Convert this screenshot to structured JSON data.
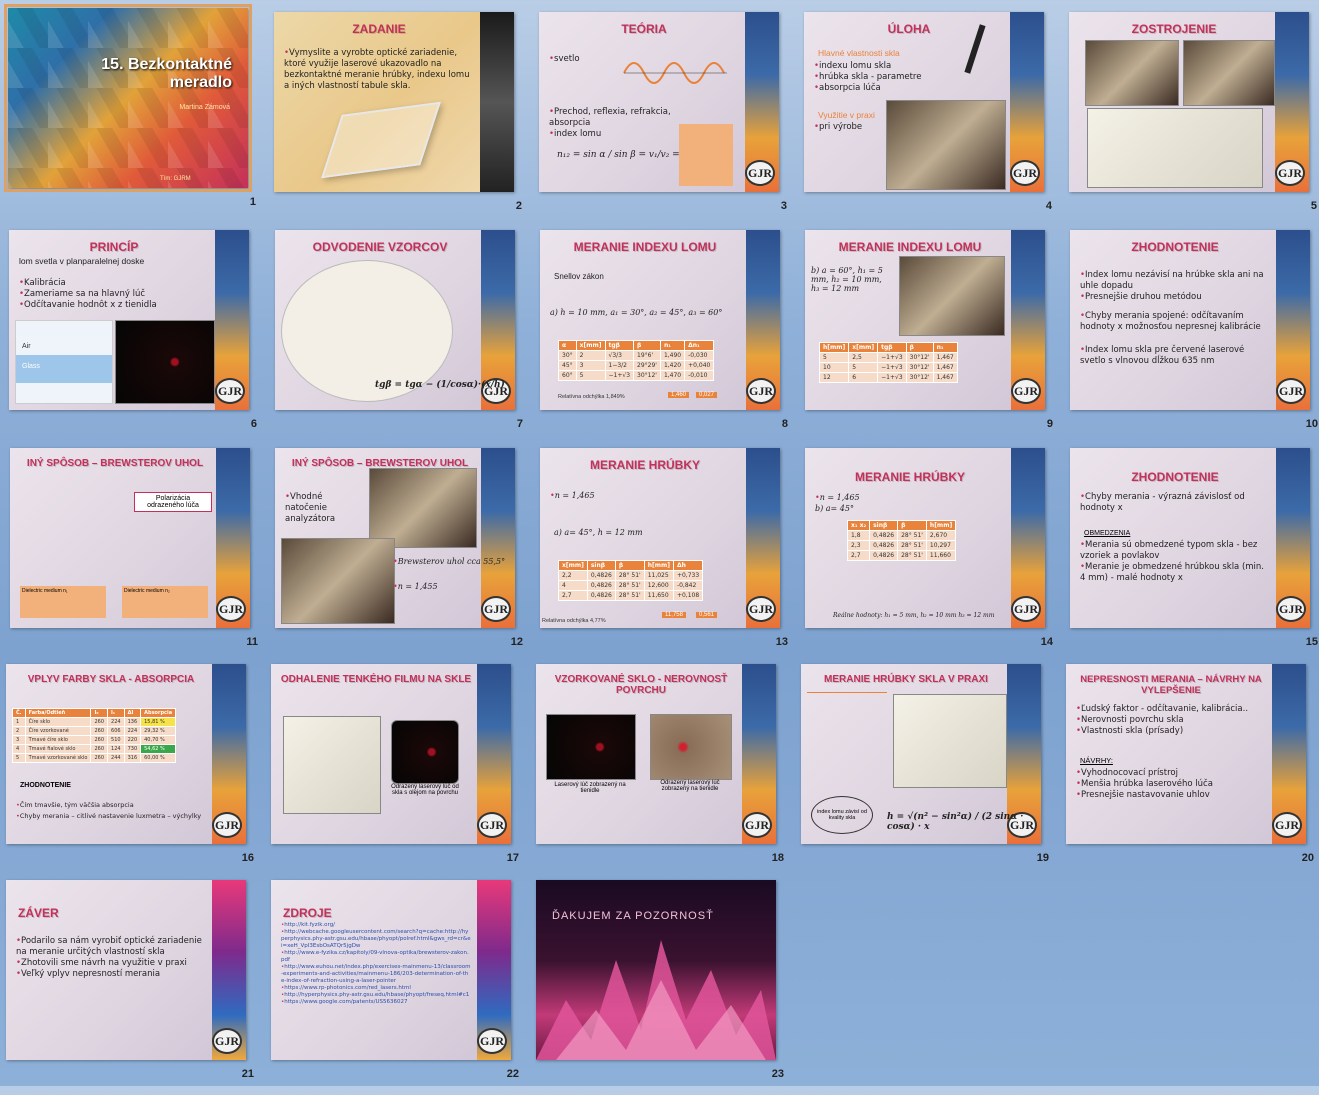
{
  "slides": [
    {
      "num": "1",
      "title": "15. Bezkontaktné meradlo",
      "subtitle": "Martina Zámová",
      "footer": "Tím: GJRM"
    },
    {
      "num": "2",
      "title": "ZADANIE",
      "bullets": [
        "Vymyslite a vyrobte optické zariadenie, ktoré využije laserové ukazovadlo na bezkontaktné meranie hrúbky, indexu lomu a iných vlastností tabule skla."
      ]
    },
    {
      "num": "3",
      "title": "TEÓRIA",
      "bullets": [
        "svetlo",
        "Prechod, reflexia, refrakcia, absorpcia",
        "index lomu"
      ],
      "formula": "n₁₂ = sin α / sin β = v₁/v₂ = n₂/n₁"
    },
    {
      "num": "4",
      "title": "ÚLOHA",
      "subhead": "Hlavné vlastnosti skla",
      "bullets": [
        "indexu lomu skla",
        "hrúbka skla - parametre",
        "absorpcia lúča"
      ],
      "subhead2": "Využitie v praxi",
      "bullets2": [
        "pri výrobe"
      ]
    },
    {
      "num": "5",
      "title": "ZOSTROJENIE"
    },
    {
      "num": "6",
      "title": "PRINCÍP",
      "intro": "lom svetla v planparalelnej doske",
      "bullets": [
        "Kalibrácia",
        "Zameriame sa na hlavný lúč",
        "Odčítavanie hodnôt x z tienidla"
      ],
      "labels": [
        "Air",
        "Glass"
      ]
    },
    {
      "num": "7",
      "title": "ODVODENIE VZORCOV",
      "formula": "tgβ = tgα − (1/cosα)·(x/h)"
    },
    {
      "num": "8",
      "title": "MERANIE INDEXU LOMU",
      "intro": "Snellov zákon",
      "case": "a) h = 10 mm, a₁ = 30°, a₂ = 45°, a₃ = 60°",
      "headers": [
        "α",
        "x[mm]",
        "tgβ",
        "β",
        "n₁",
        "Δn₁"
      ],
      "rows": [
        [
          "30°",
          "2",
          "√3/3",
          "19°6'",
          "1,490",
          "-0,030"
        ],
        [
          "45°",
          "3",
          "1−3/2",
          "29°29'",
          "1,420",
          "+0,040"
        ],
        [
          "60°",
          "5",
          "−1+√3",
          "30°12'",
          "1,470",
          "-0,010"
        ]
      ],
      "result": "1,460",
      "delta": "0,027",
      "note": "Relatívna odchýlka 1,849%"
    },
    {
      "num": "9",
      "title": "MERANIE INDEXU LOMU",
      "case": "b) a = 60°, h₁ = 5 mm, h₂ = 10 mm, h₃ = 12 mm",
      "headers": [
        "h[mm]",
        "x[mm]",
        "tgβ",
        "β",
        "n₁"
      ],
      "rows": [
        [
          "5",
          "2,5",
          "−1+√3",
          "30°12'",
          "1,467"
        ],
        [
          "10",
          "5",
          "−1+√3",
          "30°12'",
          "1,467"
        ],
        [
          "12",
          "6",
          "−1+√3",
          "30°12'",
          "1,467"
        ]
      ]
    },
    {
      "num": "10",
      "title": "ZHODNOTENIE",
      "bullets": [
        "Index lomu nezávisí na hrúbke skla ani na uhle dopadu",
        "Presnejšie druhou metódou",
        "Chyby merania spojené: odčítavaním hodnoty x možnosťou nepresnej kalibrácie",
        "Index lomu skla pre červené laserové svetlo s vlnovou dĺžkou 635 nm"
      ]
    },
    {
      "num": "11",
      "title": "INÝ SPÔSOB – BREWSTEROV UHOL",
      "box": "Polarizácia odrazeného lúča",
      "labels": [
        "Dielectric medium n₁",
        "Dielectric medium n₂"
      ]
    },
    {
      "num": "12",
      "title": "INÝ SPÔSOB – BREWSTEROV UHOL",
      "bullets": [
        "Vhodné natočenie analyzátora"
      ],
      "bullets2": [
        "Brewsterov uhol cca 55,5°",
        "n = 1,455"
      ]
    },
    {
      "num": "13",
      "title": "MERANIE HRÚBKY",
      "intro": "n = 1,465",
      "case": "a) a= 45°, h = 12 mm",
      "headers": [
        "x[mm]",
        "sinβ",
        "β",
        "h[mm]",
        "Δh"
      ],
      "rows": [
        [
          "2,2",
          "0,4826",
          "28° 51'",
          "11,025",
          "+0,733"
        ],
        [
          "4",
          "0,4826",
          "28° 51'",
          "12,600",
          "-0,842"
        ],
        [
          "2,7",
          "0,4826",
          "28° 51'",
          "11,650",
          "+0,108"
        ]
      ],
      "result": "11,758",
      "delta": "0,561",
      "note": "Relatívna odchýlka 4,77%"
    },
    {
      "num": "14",
      "title": "MERANIE HRÚBKY",
      "intro": "n = 1,465",
      "case": "b) a= 45°",
      "headers": [
        "x₁ x₂",
        "sinβ",
        "β",
        "h[mm]"
      ],
      "rows": [
        [
          "1,8",
          "0,4826",
          "28° 51'",
          "2,670"
        ],
        [
          "2,3",
          "0,4826",
          "28° 51'",
          "10,297"
        ],
        [
          "2,7",
          "0,4826",
          "28° 51'",
          "11,660"
        ]
      ],
      "note": "Reálne hodnoty: h₁ = 5 mm, h₂ = 10 mm h₃ = 12 mm"
    },
    {
      "num": "15",
      "title": "ZHODNOTENIE",
      "bullets": [
        "Chyby merania - výrazná závislosť od hodnoty x"
      ],
      "subhead": "OBMEDZENIA",
      "bullets2": [
        "Merania sú obmedzené typom skla - bez vzoriek a povlakov",
        "Meranie je obmedzené hrúbkou skla (min. 4 mm) - malé hodnoty x"
      ]
    },
    {
      "num": "16",
      "title": "VPLYV FARBY SKLA - ABSORPCIA",
      "headers": [
        "Č.",
        "Farba/Odtieň",
        "I₀",
        "I₁",
        "ΔI",
        "Absorpcia"
      ],
      "rows": [
        [
          "1",
          "Číre sklo",
          "260",
          "224",
          "136",
          "15,81 %"
        ],
        [
          "2",
          "Číre vzorkované",
          "260",
          "606",
          "224",
          "29,32 %"
        ],
        [
          "3",
          "Tmavé číre sklo",
          "260",
          "510",
          "220",
          "40,70 %"
        ],
        [
          "4",
          "Tmavé fialové sklo",
          "260",
          "124",
          "730",
          "54,62 %"
        ],
        [
          "5",
          "Tmavé vzorkované sklo",
          "260",
          "244",
          "316",
          "60,00 %"
        ]
      ],
      "subhead": "ZHODNOTENIE",
      "bullets": [
        "Čím tmavšie, tým väčšia absorpcia",
        "Chyby merania – citlivé nastavenie luxmetra – výchylky"
      ]
    },
    {
      "num": "17",
      "title": "ODHALENIE TENKÉHO FILMU NA SKLE",
      "caption": "Odrazený laserový lúč od skla s olejom na povrchu"
    },
    {
      "num": "18",
      "title": "VZORKOVANÉ SKLO - NEROVNOSŤ POVRCHU",
      "caption1": "Laserový lúč zobrazený na tienidle",
      "caption2": "Odrazený laserový lúč zobrazený na tienidle"
    },
    {
      "num": "19",
      "title": "MERANIE HRÚBKY SKLA V PRAXI",
      "oval": "index lomu závisí od kvality skla",
      "formula": "h = √(n² − sin²α) / (2 sinα · cosα) · x"
    },
    {
      "num": "20",
      "title": "NEPRESNOSTI MERANIA – NÁVRHY NA VYLEPŠENIE",
      "bullets": [
        "Ľudský faktor - odčítavanie, kalibrácia..",
        "Nerovnosti povrchu skla",
        "Vlastnosti skla (prísady)"
      ],
      "subhead": "NÁVRHY:",
      "bullets2": [
        "Vyhodnocovací prístroj",
        "Menšia hrúbka laserového lúča",
        "Presnejšie nastavovanie uhlov"
      ]
    },
    {
      "num": "21",
      "title": "ZÁVER",
      "bullets": [
        "Podarilo sa nám vyrobiť optické zariadenie na meranie určitých vlastností skla",
        "Zhotovili sme návrh na využitie v praxi",
        "Veľký vplyv nepresností merania"
      ]
    },
    {
      "num": "22",
      "title": "ZDROJE",
      "bullets": [
        "http://kit.fyzik.org/",
        "http://webcache.googleusercontent.com/search?q=cache:http://hyperphysics.phy-astr.gsu.edu/hbase/phyopt/polref.html&gws_rd=cr&ei=xeH_VpI3EsbOsATQr5jgDw",
        "http://www.e-fyzika.cz/kapitoly/09-vlnova-optika/brewsterov-zakon.pdf",
        "http://www.euhou.net/index.php/exercises-mainmenu-13/classroom-experiments-and-activities/mainmenu-186/203-determination-of-the-index-of-refraction-using-a-laser-pointer",
        "https://www.rp-photonics.com/red_lasers.html",
        "http://hyperphysics.phy-astr.gsu.edu/hbase/phyopt/freseq.html#c1",
        "https://www.google.com/patents/US5636027"
      ]
    },
    {
      "num": "23",
      "title": "ĎAKUJEM ZA POZORNOSŤ"
    }
  ]
}
